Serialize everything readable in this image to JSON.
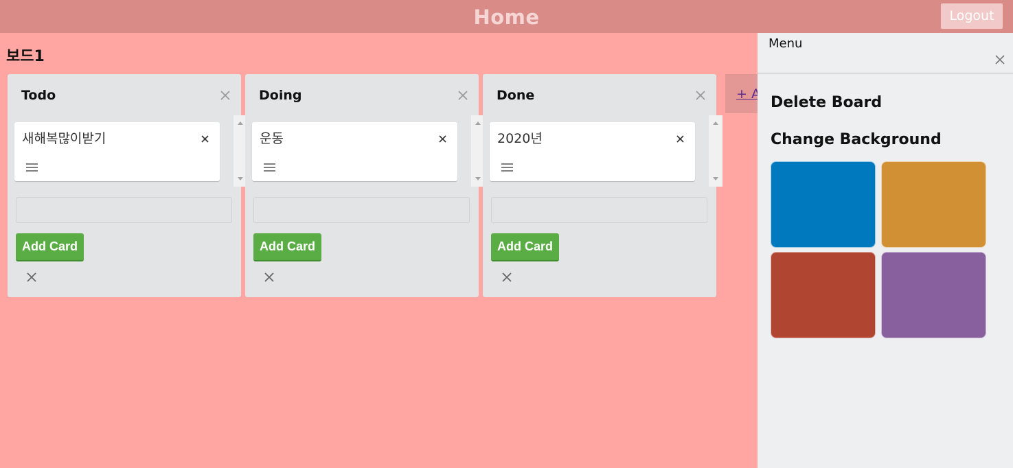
{
  "header": {
    "title": "Home",
    "logout_label": "Logout"
  },
  "board": {
    "title": "보드1"
  },
  "lists": [
    {
      "title": "Todo",
      "cards": [
        {
          "text": "새해복많이받기"
        }
      ],
      "add_card_label": "Add Card"
    },
    {
      "title": "Doing",
      "cards": [
        {
          "text": "운동"
        }
      ],
      "add_card_label": "Add Card"
    },
    {
      "title": "Done",
      "cards": [
        {
          "text": "2020년"
        }
      ],
      "add_card_label": "Add Card"
    }
  ],
  "add_list": {
    "label": "+ A"
  },
  "menu": {
    "label": "Menu",
    "delete_board_label": "Delete Board",
    "change_background_label": "Change Background",
    "background_colors": [
      "#0079bf",
      "#d29034",
      "#b04632",
      "#89609e"
    ]
  },
  "colors": {
    "board_background": "#ffa5a2",
    "header_background": "#d98b88",
    "add_card_button": "#5aac44",
    "list_background": "#e2e4e6",
    "menu_background": "#edeff0"
  },
  "icons": [
    "close-icon",
    "hamburger-icon",
    "scroll-up-arrow-icon",
    "scroll-down-arrow-icon"
  ]
}
